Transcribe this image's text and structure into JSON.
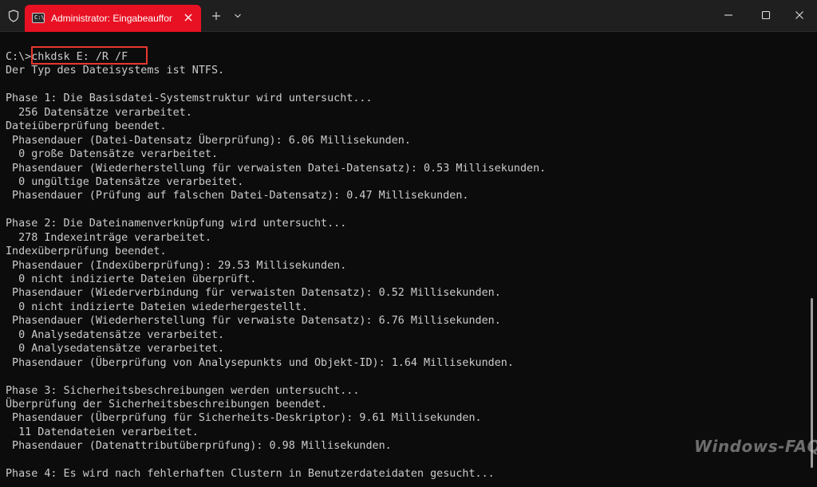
{
  "window": {
    "tab_title": "Administrator: Eingabeauffon",
    "tab_icon_text": "C:\\",
    "accent_color": "#e81123"
  },
  "terminal": {
    "lines": [
      "C:\\>chkdsk E: /R /F",
      "Der Typ des Dateisystems ist NTFS.",
      "",
      "Phase 1: Die Basisdatei-Systemstruktur wird untersucht...",
      "  256 Datensätze verarbeitet.",
      "Dateiüberprüfung beendet.",
      " Phasendauer (Datei-Datensatz Überprüfung): 6.06 Millisekunden.",
      "  0 große Datensätze verarbeitet.",
      " Phasendauer (Wiederherstellung für verwaisten Datei-Datensatz): 0.53 Millisekunden.",
      "  0 ungültige Datensätze verarbeitet.",
      " Phasendauer (Prüfung auf falschen Datei-Datensatz): 0.47 Millisekunden.",
      "",
      "Phase 2: Die Dateinamenverknüpfung wird untersucht...",
      "  278 Indexeinträge verarbeitet.",
      "Indexüberprüfung beendet.",
      " Phasendauer (Indexüberprüfung): 29.53 Millisekunden.",
      "  0 nicht indizierte Dateien überprüft.",
      " Phasendauer (Wiederverbindung für verwaisten Datensatz): 0.52 Millisekunden.",
      "  0 nicht indizierte Dateien wiederhergestellt.",
      " Phasendauer (Wiederherstellung für verwaiste Datensatz): 6.76 Millisekunden.",
      "  0 Analysedatensätze verarbeitet.",
      "  0 Analysedatensätze verarbeitet.",
      " Phasendauer (Überprüfung von Analysepunkts und Objekt-ID): 1.64 Millisekunden.",
      "",
      "Phase 3: Sicherheitsbeschreibungen werden untersucht...",
      "Überprüfung der Sicherheitsbeschreibungen beendet.",
      " Phasendauer (Überprüfung für Sicherheits-Deskriptor): 9.61 Millisekunden.",
      "  11 Datendateien verarbeitet.",
      " Phasendauer (Datenattributüberprüfung): 0.98 Millisekunden.",
      "",
      "Phase 4: Es wird nach fehlerhaften Clustern in Benutzerdateidaten gesucht..."
    ]
  },
  "watermark": "Windows-FAQ",
  "icons": {
    "shield": "shield-icon",
    "tab": "terminal-icon",
    "close": "close-icon",
    "add": "plus-icon",
    "dropdown": "chevron-down-icon",
    "minimize": "minimize-icon",
    "maximize": "maximize-icon",
    "window_close": "window-close-icon"
  }
}
